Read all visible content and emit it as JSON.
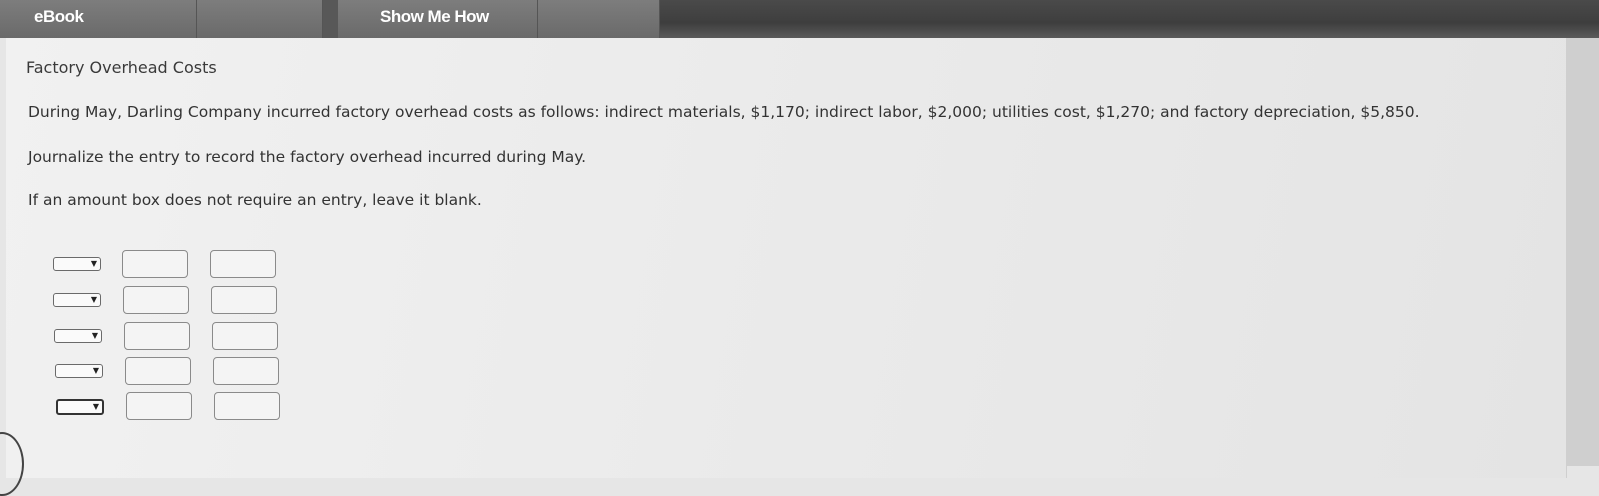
{
  "tabs": [
    {
      "label": "eBook"
    },
    {
      "label": ""
    },
    {
      "label": "Show Me How"
    },
    {
      "label": ""
    }
  ],
  "problem": {
    "title": "Factory Overhead Costs",
    "statement": "During May, Darling Company incurred factory overhead costs as follows: indirect materials, $1,170; indirect labor, $2,000; utilities cost, $1,270; and factory depreciation, $5,850.",
    "instruction": "Journalize the entry to record the factory overhead incurred during May.",
    "note": "If an amount box does not require an entry, leave it blank."
  },
  "journal": {
    "rows": [
      {
        "account": "",
        "debit": "",
        "credit": ""
      },
      {
        "account": "",
        "debit": "",
        "credit": ""
      },
      {
        "account": "",
        "debit": "",
        "credit": ""
      },
      {
        "account": "",
        "debit": "",
        "credit": ""
      },
      {
        "account": "",
        "debit": "",
        "credit": ""
      }
    ],
    "dropdown_icon": "caret-down-icon"
  }
}
